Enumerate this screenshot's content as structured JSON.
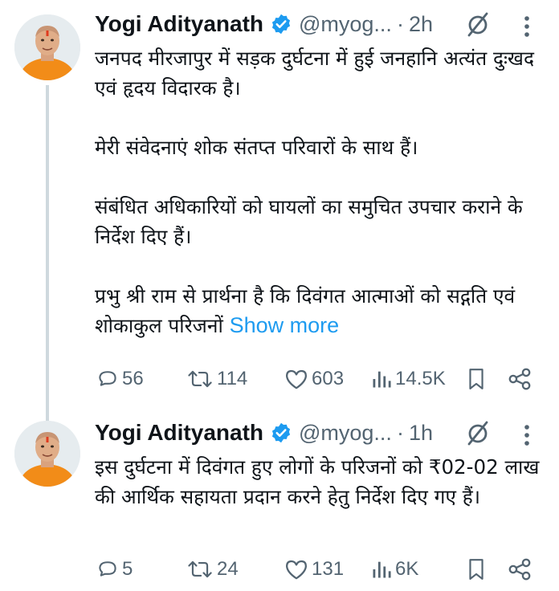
{
  "tweets": [
    {
      "author_name": "Yogi Adityanath",
      "handle": "@myog...",
      "separator": "·",
      "time": "2h",
      "text": "जनपद मीरजापुर में सड़क दुर्घटना में हुई जनहानि अत्यंत दुःखद एवं हृदय विदारक है।\n\nमेरी संवेदनाएं शोक संतप्त परिवारों के साथ हैं।\n\nसंबंधित अधिकारियों को घायलों का समुचित उपचार कराने के निर्देश दिए हैं।\n\nप्रभु श्री राम से प्रार्थना है कि दिवंगत आत्माओं को सद्गति एवं शोकाकुल परिजनों",
      "show_more": "Show more",
      "replies": "56",
      "reposts": "114",
      "likes": "603",
      "views": "14.5K"
    },
    {
      "author_name": "Yogi Adityanath",
      "handle": "@myog...",
      "separator": "·",
      "time": "1h",
      "text": "इस दुर्घटना में दिवंगत हुए लोगों के परिजनों को ₹02-02 लाख की आर्थिक सहायता प्रदान करने हेतु निर्देश दिए गए हैं।",
      "replies": "5",
      "reposts": "24",
      "likes": "131",
      "views": "6K"
    }
  ],
  "icons": {
    "verified": "verified-badge-icon",
    "mute": "mute-icon",
    "more": "more-options-icon",
    "reply": "reply-icon",
    "repost": "repost-icon",
    "like": "like-icon",
    "views": "views-icon",
    "bookmark": "bookmark-icon",
    "share": "share-icon"
  },
  "colors": {
    "verified": "#1d9bf0",
    "link": "#1d9bf0",
    "secondary_text": "#536471",
    "primary_text": "#0f1419",
    "thread_line": "#cfd9de"
  }
}
